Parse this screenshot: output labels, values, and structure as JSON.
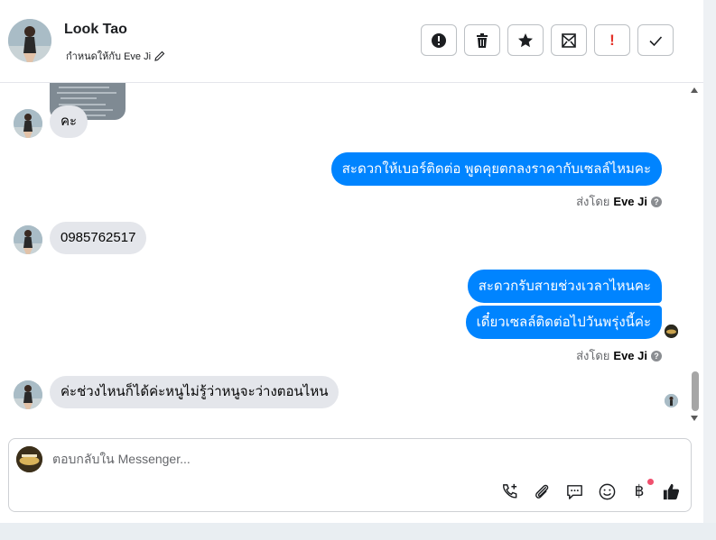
{
  "header": {
    "contact_name": "Look Tao",
    "assigned_label": "กำหนดให้กับ Eve Ji",
    "actions": [
      {
        "name": "report-spam-button",
        "icon": "alert-circle-icon"
      },
      {
        "name": "delete-button",
        "icon": "trash-icon"
      },
      {
        "name": "star-button",
        "icon": "star-icon"
      },
      {
        "name": "mark-unread-button",
        "icon": "envelope-icon"
      },
      {
        "name": "follow-up-button",
        "icon": "exclamation-icon",
        "text": "!"
      },
      {
        "name": "mark-done-button",
        "icon": "check-icon"
      }
    ]
  },
  "messages": [
    {
      "id": "m1",
      "direction": "in",
      "text": "คะ"
    },
    {
      "id": "m2",
      "direction": "out",
      "text": "สะดวกให้เบอร์ติดต่อ พูดคุยตกลงราคากับเซลล์ไหมคะ"
    },
    {
      "id": "s1",
      "sent_by_prefix": "ส่งโดย",
      "sent_by_name": "Eve Ji",
      "help": "?"
    },
    {
      "id": "m3",
      "direction": "in",
      "text": "0985762517"
    },
    {
      "id": "m4",
      "direction": "out",
      "text": "สะดวกรับสายช่วงเวลาไหนคะ"
    },
    {
      "id": "m5",
      "direction": "out",
      "text": "เดี๋ยวเซลล์ติดต่อไปวันพรุ่งนี้ค่ะ"
    },
    {
      "id": "s2",
      "sent_by_prefix": "ส่งโดย",
      "sent_by_name": "Eve Ji",
      "help": "?"
    },
    {
      "id": "m6",
      "direction": "in",
      "text": "ค่ะช่วงไหนก็ได้ค่ะหนูไม่รู้ว่าหนูจะว่างตอนไหน"
    }
  ],
  "composer": {
    "placeholder": "ตอบกลับใน Messenger...",
    "tools": [
      "phone-add-icon",
      "paperclip-icon",
      "saved-replies-icon",
      "emoji-icon",
      "baht-payment-icon",
      "like-icon"
    ],
    "baht_symbol": "฿"
  },
  "colors": {
    "accent": "#0084ff",
    "incoming_bubble": "#e4e6eb",
    "notification_dot": "#f0506e",
    "follow_up": "#e4332a"
  }
}
